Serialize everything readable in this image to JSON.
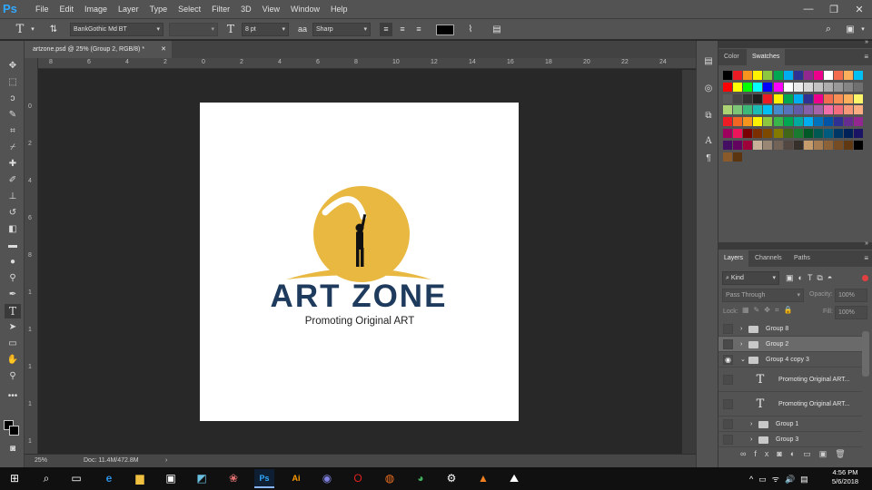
{
  "menubar": {
    "logo": "Ps",
    "items": [
      "File",
      "Edit",
      "Image",
      "Layer",
      "Type",
      "Select",
      "Filter",
      "3D",
      "View",
      "Window",
      "Help"
    ],
    "minimize": "—",
    "restore": "❐",
    "close": "✕"
  },
  "options": {
    "font_family": "BankGothic Md BT",
    "font_style": "",
    "font_size": "8 pt",
    "antialias": "Sharp",
    "text_color": "#000000"
  },
  "document": {
    "tab_title": "artzone.psd @ 25% (Group 2, RGB/8) *",
    "zoom": "25%",
    "doc_size": "Doc: 11.4M/472.8M"
  },
  "rulers": {
    "top": [
      "8",
      "6",
      "4",
      "2",
      "0",
      "2",
      "4",
      "6",
      "8",
      "10",
      "12",
      "14",
      "16",
      "18",
      "20",
      "22",
      "24"
    ],
    "left": [
      "0",
      "2",
      "4",
      "6",
      "8",
      "1",
      "1",
      "1",
      "1",
      "1",
      "2"
    ]
  },
  "artwork": {
    "logo_title": "ART ZONE",
    "tagline": "Promoting Original ART",
    "colors": {
      "sun": "#e8b840",
      "navy": "#1e3a5c",
      "accent": "#e8b840"
    }
  },
  "color_panel": {
    "tabs": [
      "Color",
      "Swatches"
    ],
    "active_tab": "Swatches"
  },
  "layers_panel": {
    "tabs": [
      "Layers",
      "Channels",
      "Paths"
    ],
    "filter_kind": "Kind",
    "blend_mode": "Pass Through",
    "opacity_label": "Opacity:",
    "opacity_value": "100%",
    "lock_label": "Lock:",
    "fill_label": "Fill:",
    "fill_value": "100%",
    "layers": [
      {
        "name": "Group 8",
        "type": "group",
        "visible": false,
        "selected": false,
        "indent": 0
      },
      {
        "name": "Group 2",
        "type": "group",
        "visible": false,
        "selected": true,
        "indent": 0
      },
      {
        "name": "Group 4 copy 3",
        "type": "group",
        "visible": true,
        "selected": false,
        "indent": 0,
        "expanded": true
      },
      {
        "name": "Promoting Original ART...",
        "type": "text",
        "visible": false,
        "selected": false,
        "indent": 1
      },
      {
        "name": "Promoting Original ART...",
        "type": "text",
        "visible": false,
        "selected": false,
        "indent": 1
      },
      {
        "name": "Group 1",
        "type": "group",
        "visible": false,
        "selected": false,
        "indent": 1
      },
      {
        "name": "Group 3",
        "type": "group",
        "visible": false,
        "selected": false,
        "indent": 1
      }
    ]
  },
  "taskbar": {
    "time": "4:56 PM",
    "date": "5/6/2018"
  }
}
